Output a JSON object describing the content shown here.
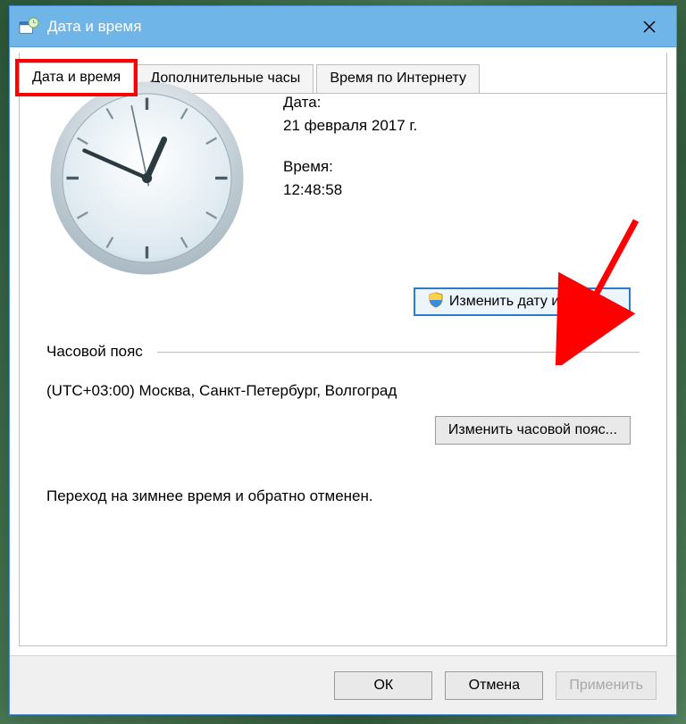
{
  "window": {
    "title": "Дата и время"
  },
  "tabs": [
    {
      "label": "Дата и время",
      "active": true
    },
    {
      "label": "Дополнительные часы",
      "active": false
    },
    {
      "label": "Время по Интернету",
      "active": false
    }
  ],
  "date_section": {
    "date_label": "Дата:",
    "date_value": "21 февраля 2017 г.",
    "time_label": "Время:",
    "time_value": "12:48:58",
    "change_datetime_btn": "Изменить дату и время..."
  },
  "timezone_section": {
    "heading": "Часовой пояс",
    "value": "(UTC+03:00) Москва, Санкт-Петербург, Волгоград",
    "change_tz_btn": "Изменить часовой пояс..."
  },
  "dst_note": "Переход на зимнее время и обратно отменен.",
  "footer": {
    "ok": "ОК",
    "cancel": "Отмена",
    "apply": "Применить"
  },
  "clock": {
    "hour": 12,
    "minute": 48,
    "second": 58
  },
  "colors": {
    "accent": "#6fb5e8",
    "highlight": "#f00",
    "focus_border": "#2a7cd0"
  }
}
